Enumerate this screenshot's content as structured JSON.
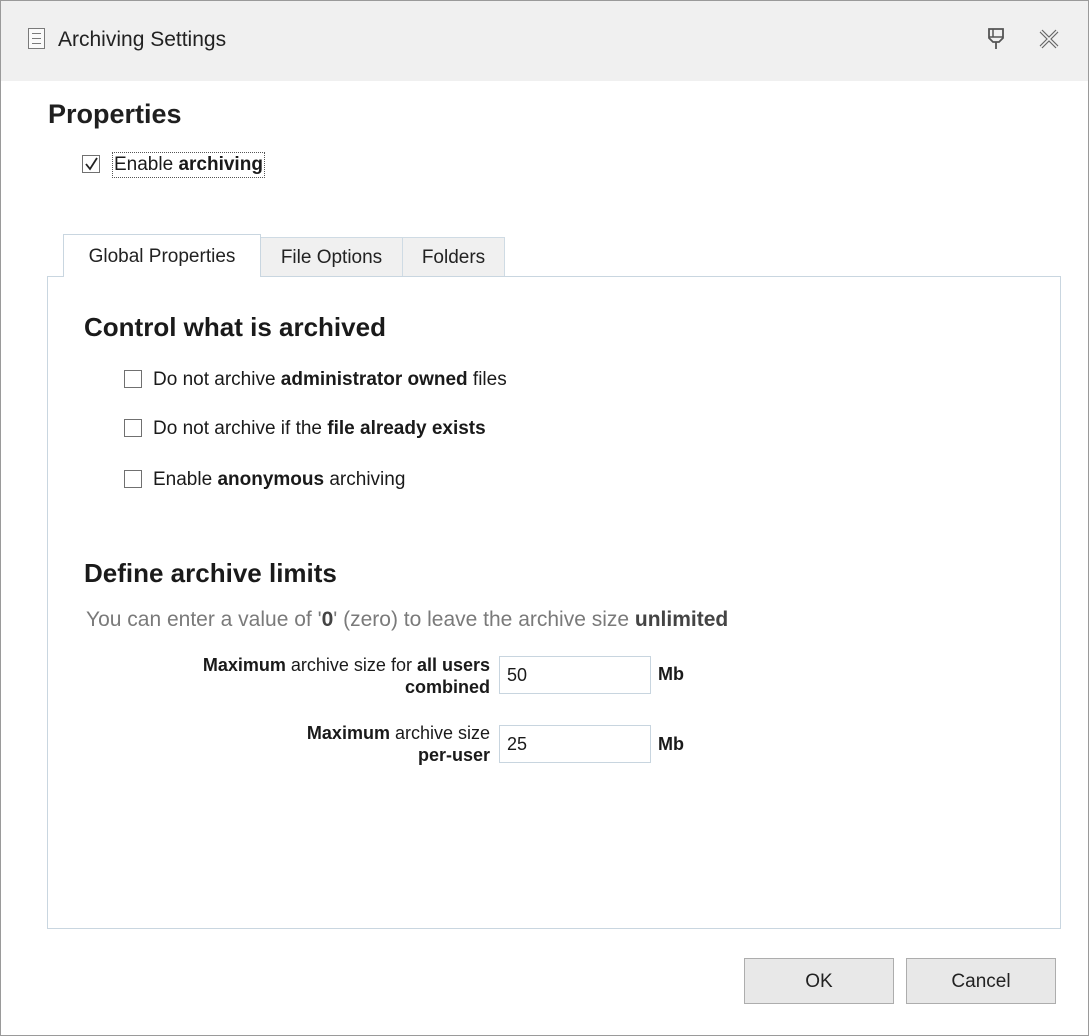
{
  "window": {
    "title": "Archiving Settings"
  },
  "properties": {
    "title": "Properties",
    "enable_archiving": {
      "prefix": "Enable ",
      "bold": "archiving",
      "checked": true
    }
  },
  "tabs": [
    {
      "label": "Global Properties",
      "active": true
    },
    {
      "label": "File Options",
      "active": false
    },
    {
      "label": "Folders",
      "active": false
    }
  ],
  "control": {
    "heading": "Control what is archived",
    "options": [
      {
        "before": "Do not archive ",
        "bold": "administrator owned",
        "after": " files",
        "checked": false
      },
      {
        "before": "Do not archive if the ",
        "bold": "file already exists",
        "after": "",
        "checked": false
      },
      {
        "before": "Enable ",
        "bold": "anonymous",
        "after": " archiving",
        "checked": false
      }
    ]
  },
  "limits": {
    "heading": "Define archive limits",
    "hint": {
      "a": "You can enter a value of '",
      "b": "0",
      "c": "' (zero) to leave the archive size ",
      "d": "unlimited"
    },
    "all_users": {
      "label_bold1": "Maximum",
      "label_text": " archive size for ",
      "label_bold2": "all users",
      "label_bold3": "combined",
      "value": "50",
      "unit": "Mb"
    },
    "per_user": {
      "label_bold1": "Maximum",
      "label_text": " archive size",
      "label_bold2": "per-user",
      "value": "25",
      "unit": "Mb"
    }
  },
  "buttons": {
    "ok": "OK",
    "cancel": "Cancel"
  },
  "icons": {
    "title": "list-icon",
    "pin": "pin-icon",
    "close": "close-icon"
  },
  "colors": {
    "titlebar": "#f0f0f0",
    "tab_border": "#c9d6e0",
    "hint_text": "#7a7a7a"
  }
}
